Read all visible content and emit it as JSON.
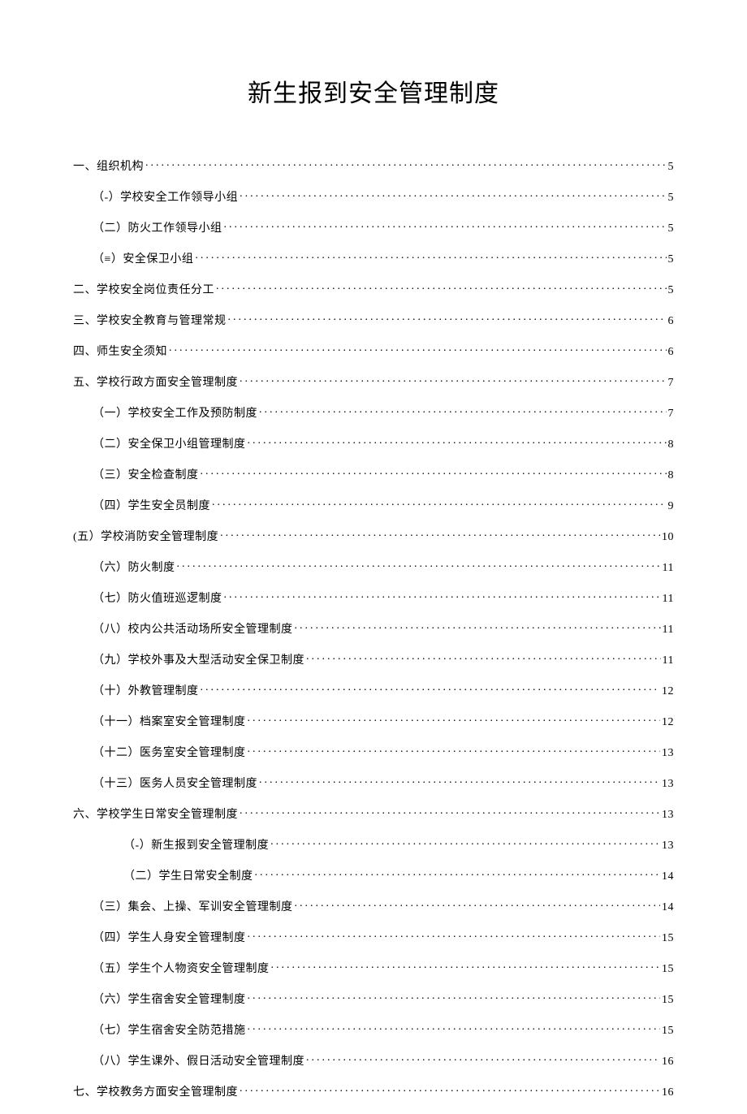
{
  "title": "新生报到安全管理制度",
  "toc": [
    {
      "label": "一、组织机构",
      "page": "5",
      "level": 0
    },
    {
      "label": "（-）学校安全工作领导小组",
      "page": "5",
      "level": 1
    },
    {
      "label": "（二）防火工作领导小组",
      "page": "5",
      "level": 1
    },
    {
      "label": "（≡）安全保卫小组",
      "page": "5",
      "level": 1
    },
    {
      "label": "二、学校安全岗位责任分工",
      "page": "5",
      "level": 0
    },
    {
      "label": "三、学校安全教育与管理常规",
      "page": "6",
      "level": 0
    },
    {
      "label": "四、师生安全须知",
      "page": "6",
      "level": 0
    },
    {
      "label": "五、学校行政方面安全管理制度",
      "page": "7",
      "level": 0
    },
    {
      "label": "（一）学校安全工作及预防制度",
      "page": "7",
      "level": 1
    },
    {
      "label": "（二）安全保卫小组管理制度",
      "page": "8",
      "level": 1
    },
    {
      "label": "（三）安全检查制度",
      "page": "8",
      "level": 1
    },
    {
      "label": "（四）学生安全员制度",
      "page": "9",
      "level": 1
    },
    {
      "label": "(五）学校消防安全管理制度",
      "page": "10",
      "level": 0
    },
    {
      "label": "（六）防火制度",
      "page": "11",
      "level": 1
    },
    {
      "label": "（七）防火值班巡逻制度",
      "page": "11",
      "level": 1
    },
    {
      "label": "（八）校内公共活动场所安全管理制度",
      "page": "11",
      "level": 1
    },
    {
      "label": "（九）学校外事及大型活动安全保卫制度",
      "page": "11",
      "level": 1
    },
    {
      "label": "（十）外教管理制度",
      "page": "12",
      "level": 1
    },
    {
      "label": "（十一）档案室安全管理制度",
      "page": "12",
      "level": 1
    },
    {
      "label": "（十二）医务室安全管理制度",
      "page": "13",
      "level": 1
    },
    {
      "label": "（十三）医务人员安全管理制度",
      "page": "13",
      "level": 1
    },
    {
      "label": "六、学校学生日常安全管理制度",
      "page": "13",
      "level": 0
    },
    {
      "label": "（-）新生报到安全管理制度",
      "page": "13",
      "level": 2
    },
    {
      "label": "（二）学生日常安全制度",
      "page": "14",
      "level": 2
    },
    {
      "label": "（三）集会、上操、军训安全管理制度",
      "page": "14",
      "level": 1
    },
    {
      "label": "（四）学生人身安全管理制度",
      "page": "15",
      "level": 1
    },
    {
      "label": "（五）学生个人物资安全管理制度",
      "page": "15",
      "level": 1
    },
    {
      "label": "（六）学生宿舍安全管理制度",
      "page": "15",
      "level": 1
    },
    {
      "label": "（七）学生宿舍安全防范措施",
      "page": "15",
      "level": 1
    },
    {
      "label": "（八）学生课外、假日活动安全管理制度",
      "page": "16",
      "level": 1
    },
    {
      "label": "七、学校教务方面安全管理制度",
      "page": "16",
      "level": 0
    }
  ]
}
